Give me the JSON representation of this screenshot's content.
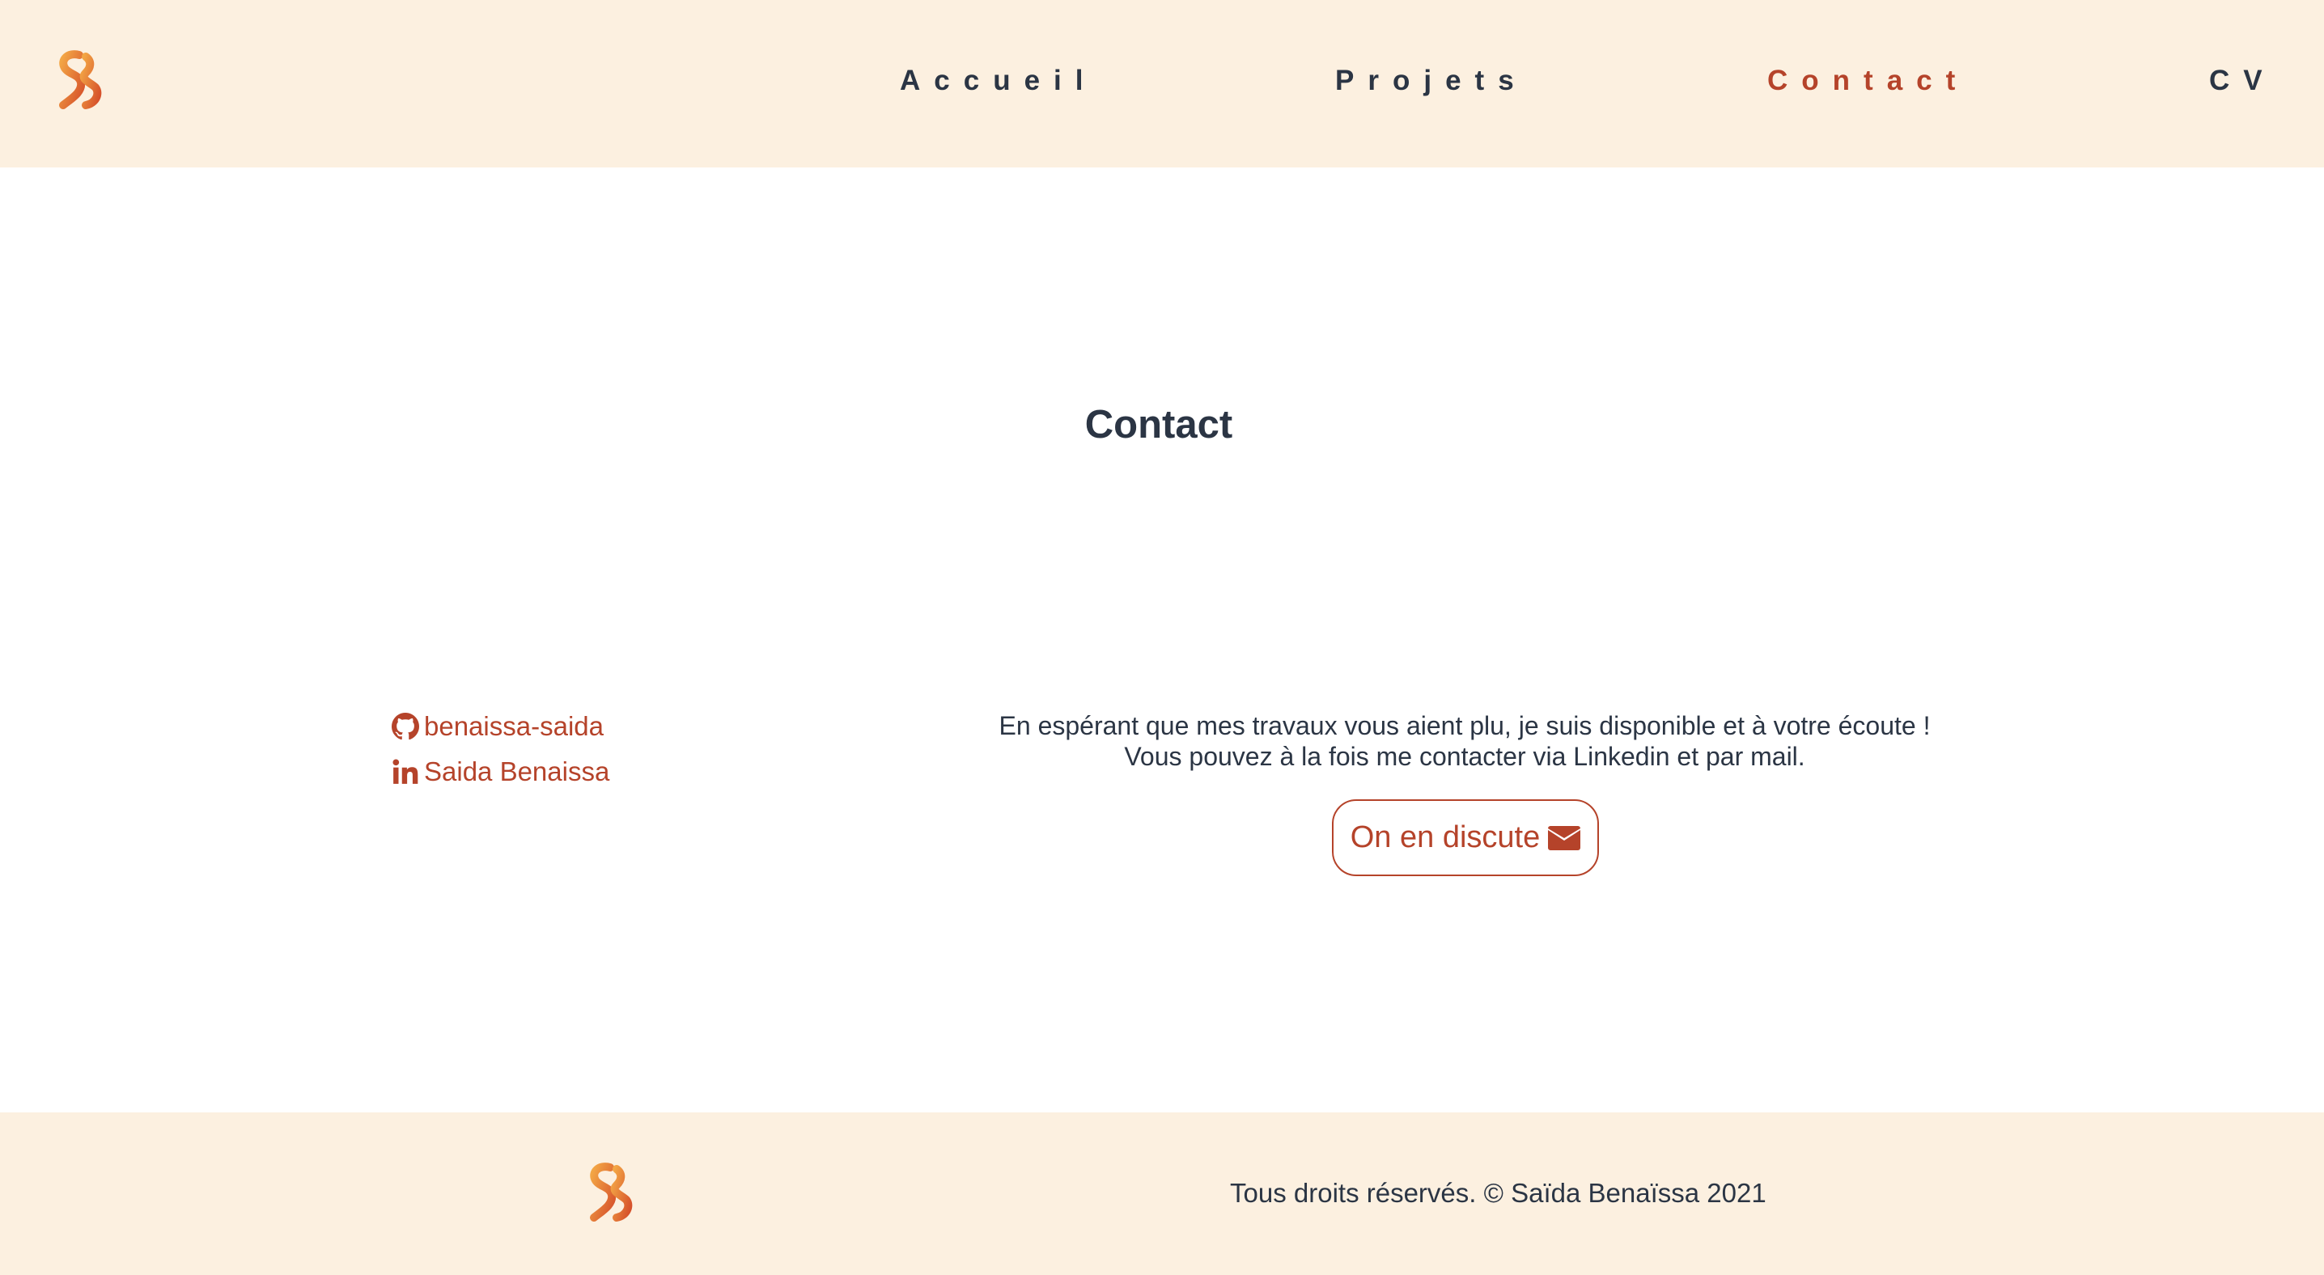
{
  "brand": {
    "logo_icon": "ss-monogram-logo",
    "colors": {
      "accent": "#b5432a",
      "text": "#2b3544",
      "header_bg": "#fcf0e0",
      "logo_gradient_start": "#f0a040",
      "logo_gradient_end": "#d9552a"
    }
  },
  "nav": {
    "items": [
      {
        "label": "Accueil",
        "active": false
      },
      {
        "label": "Projets",
        "active": false
      },
      {
        "label": "Contact",
        "active": true
      },
      {
        "label": "CV",
        "active": false
      }
    ]
  },
  "main": {
    "title": "Contact",
    "social": {
      "github": {
        "label": "benaissa-saida",
        "icon": "github-icon"
      },
      "linkedin": {
        "label": "Saida Benaissa",
        "icon": "linkedin-icon"
      }
    },
    "message": {
      "line1": "En espérant que mes travaux vous aient plu, je suis disponible et à votre écoute !",
      "line2": "Vous pouvez à la fois me contacter via Linkedin et par mail."
    },
    "cta": {
      "label": "On en discute",
      "icon": "envelope-icon"
    }
  },
  "footer": {
    "copyright": "Tous droits réservés. © Saïda Benaïssa 2021"
  }
}
